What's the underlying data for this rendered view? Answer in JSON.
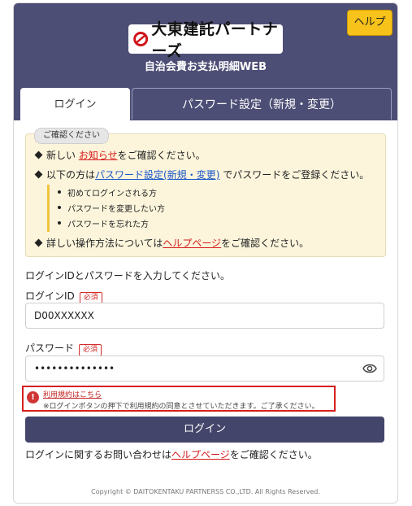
{
  "header": {
    "help_label": "ヘルプ",
    "logo_text": "大東建託パートナーズ",
    "subtitle": "自治会費お支払明細WEB",
    "bg_color": "#4d4e75",
    "help_color": "#f7c21a"
  },
  "tabs": [
    {
      "label": "ログイン",
      "active": true
    },
    {
      "label": "パスワード設定（新規・変更）",
      "active": false
    }
  ],
  "notice": {
    "tag": "ご確認ください",
    "line1_pre": "新しい ",
    "line1_link": "お知らせ",
    "line1_post": "をご確認ください。",
    "line2_pre": "以下の方は",
    "line2_link": "パスワード設定(新規・変更)",
    "line2_post": " でパスワードをご登録ください。",
    "sub_items": [
      "初めてログインされる方",
      "パスワードを変更したい方",
      "パスワードを忘れた方"
    ],
    "line3_pre": "詳しい操作方法については",
    "line3_link": "ヘルプページ",
    "line3_post": "をご確認ください。"
  },
  "form": {
    "instruction": "ログインIDとパスワードを入力してください。",
    "login_id_label": "ログインID",
    "required_label": "必須",
    "login_id_value": "D00XXXXXX",
    "password_label": "パスワード",
    "password_value": "••••••••••••••"
  },
  "terms": {
    "link": "利用規約はこちら",
    "note": "※ログインボタンの押下で利用規約の同意とさせていただきます。ご了承ください。"
  },
  "login_button": "ログイン",
  "contact": {
    "pre": "ログインに関するお問い合わせは",
    "link": "ヘルプページ",
    "post": "をご確認ください。"
  },
  "copyright": "Copyright © DAITOKENTAKU PARTNERSS CO.,LTD. All Rights Reserved."
}
